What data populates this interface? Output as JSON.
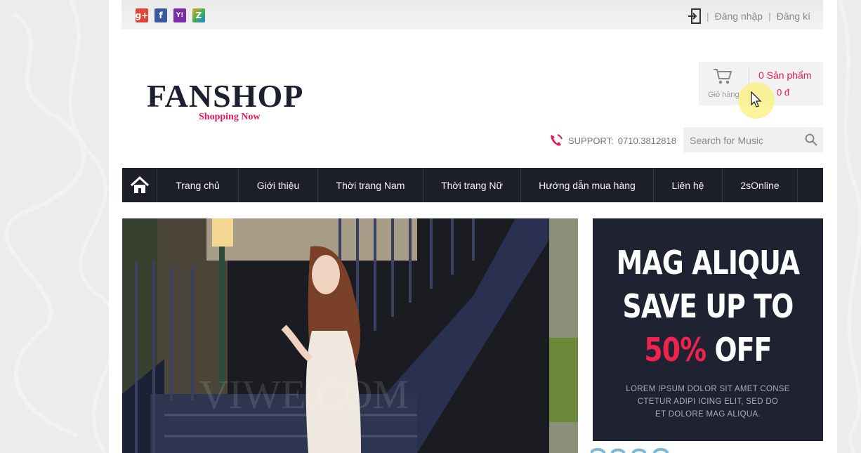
{
  "social": [
    {
      "icon": "google-plus-icon",
      "glyph": "g+",
      "color": "#e0453a"
    },
    {
      "icon": "facebook-icon",
      "glyph": "f",
      "color": "#3b5a9a"
    },
    {
      "icon": "yahoo-icon",
      "glyph": "Y!",
      "color": "#7b2ea5"
    },
    {
      "icon": "zing-icon",
      "glyph": "Z",
      "color": "#f0a020"
    }
  ],
  "auth": {
    "login": "Đăng nhập",
    "separator": "|",
    "register": "Đăng kí"
  },
  "logo": {
    "name": "FANSHOP",
    "tagline": "Shopping Now"
  },
  "cart": {
    "label": "Giỏ hàng",
    "count": "0 Sản phẩm",
    "total": "0 đ"
  },
  "support": {
    "label": "SUPPORT:",
    "phone": "0710.3812818"
  },
  "search": {
    "placeholder": "Search for Music"
  },
  "nav": {
    "items": [
      "Trang chủ",
      "Giới thiệu",
      "Thời trang Nam",
      "Thời trang Nữ",
      "Hướng dẫn mua hàng",
      "Liên hệ",
      "2sOnline"
    ]
  },
  "banner": {
    "watermark": "VIWE.COM"
  },
  "promo": {
    "line1": "MAG ALIQUA",
    "line2": "SAVE UP TO",
    "percent": "50%",
    "off": "OFF",
    "body1": "LOREM IPSUM DOLOR SIT AMET CONSE",
    "body2": "CTETUR ADIPI ICING ELIT, SED DO",
    "body3": "ET DOLORE MAG ALIQUA."
  },
  "colors": {
    "accent": "#e0195a",
    "nav_bg": "#1d202b",
    "promo_bg": "#1f2230"
  }
}
